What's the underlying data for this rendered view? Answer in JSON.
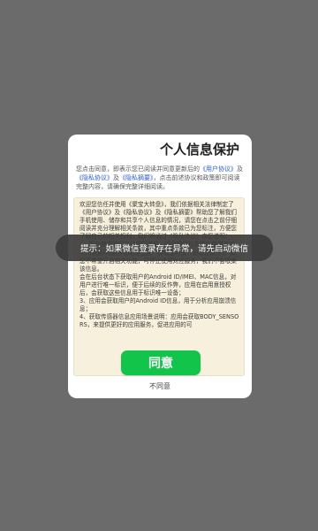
{
  "dialog": {
    "title": "个人信息保护",
    "intro": {
      "part1": "您点击同意，即表示您已阅读并同意更新后的",
      "link_user_agreement": "《用户协议》",
      "part2": "及",
      "link_privacy_agreement": "《隐私协议》",
      "part3": "及",
      "link_privacy_summary": "《隐私摘要》",
      "part4": "，点击前述协议和政策即可阅读完整内容，请确保完整详细阅读。"
    },
    "content": [
      "欢迎您信任并使用《聚宝大转盘》，我们依据相关法律制定了《用户协议》及《隐私协议》及《隐私摘要》帮助您了解我们手机使用、储存和共享个人信息的情况，请您在点击之前仔细阅读并充分理解相关条款，其中重点条款已为您标注，方便您了解自己的相关权利，我们将通过《隐私协议》向您说明：",
      "1、您在使用我们产品或服务时，将会提供与具体功能相关的个人信息(可能涉及地理位置、读取通讯录、运动记录等)，如您不希望开启相关功能，可停止使用对应服务，我们不会收集该信息。",
      "会在后台状态下获取用户的Android ID/IMEI、MAC信息，对用户进行唯一标识，便于后续的反作弊，应用在启用意授权后，会获取这些信息用于标识唯一设备；",
      "3、应用会获取用户的Android ID信息，用于分析应用崩溃信息；",
      "4、获取传感器信息应用场景说明：应用会获取BODY_SENSORS，来提供更好的应用服务，促进应用的可"
    ],
    "agree_label": "同意",
    "disagree_label": "不同意"
  },
  "toast": {
    "message": "提示：如果微信登录存在异常，请先启动微信"
  },
  "colors": {
    "background": "#6b6b6b",
    "agree_button": "#13c44b",
    "content_background": "#f7f0dc",
    "link": "#2a5bd7"
  }
}
